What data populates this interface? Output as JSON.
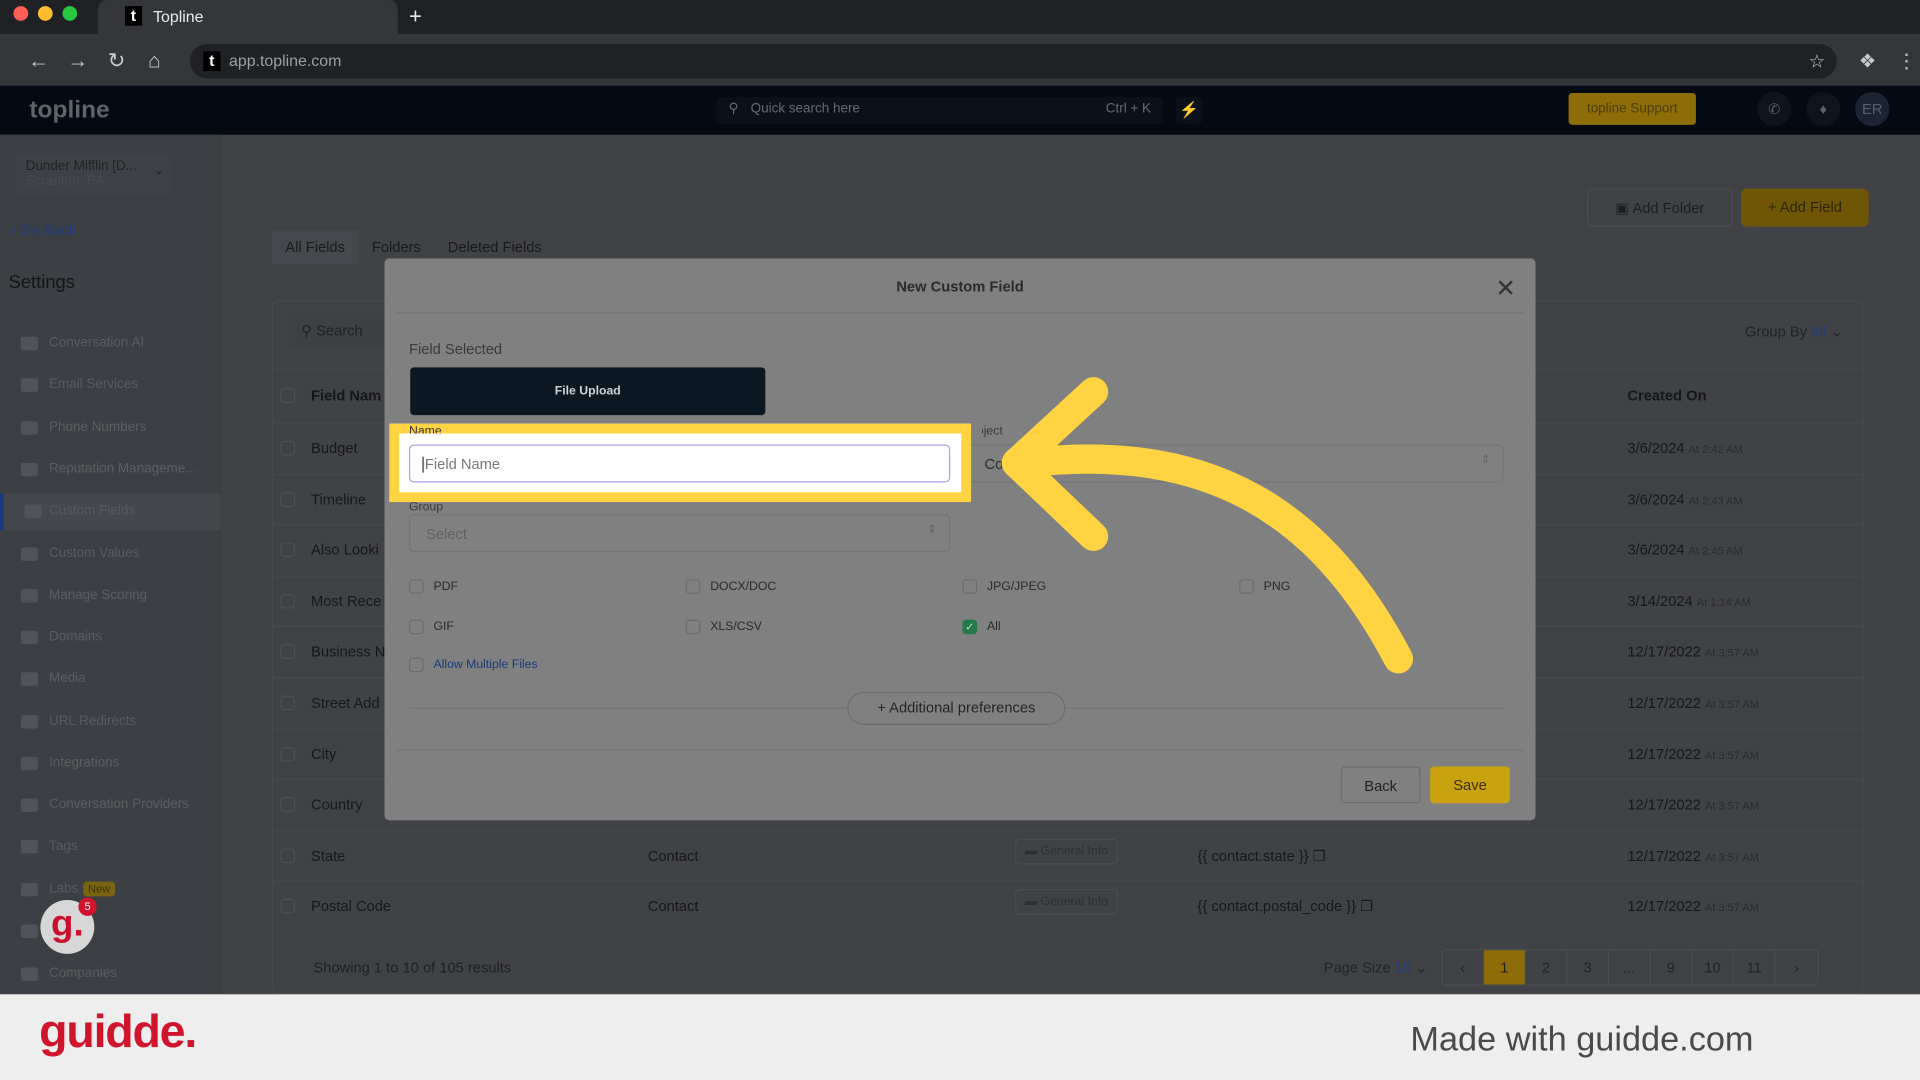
{
  "browser": {
    "tab_title": "Topline",
    "url": "app.topline.com",
    "favicon": "t"
  },
  "app": {
    "logo": "topline",
    "search_placeholder": "Quick search here",
    "search_shortcut": "Ctrl + K",
    "support_label": "topline Support",
    "avatar_initials": "ER"
  },
  "location": {
    "name": "Dunder Mifflin [D...",
    "sub": "Scranton, PA"
  },
  "sidebar": {
    "go_back": "Go Back",
    "title": "Settings",
    "new_badge": "New",
    "items": [
      {
        "label": "Conversation AI"
      },
      {
        "label": "Email Services"
      },
      {
        "label": "Phone Numbers"
      },
      {
        "label": "Reputation Manageme..."
      },
      {
        "label": "Custom Fields",
        "active": true
      },
      {
        "label": "Custom Values"
      },
      {
        "label": "Manage Scoring"
      },
      {
        "label": "Domains"
      },
      {
        "label": "Media"
      },
      {
        "label": "URL Redirects"
      },
      {
        "label": "Integrations"
      },
      {
        "label": "Conversation Providers"
      },
      {
        "label": "Tags"
      },
      {
        "label": "Labs"
      },
      {
        "label": "ogs"
      },
      {
        "label": "Companies"
      }
    ]
  },
  "main": {
    "add_folder": "Add Folder",
    "add_field": "+ Add Field",
    "tabs": [
      "All Fields",
      "Folders",
      "Deleted Fields"
    ],
    "search_placeholder": "Search",
    "group_by_label": "Group By",
    "group_by_value": "All",
    "columns": {
      "name": "Field Nam",
      "created": "Created On"
    },
    "rows": [
      {
        "name": "Budget",
        "date": "3/6/2024",
        "time": "At 2:42 AM"
      },
      {
        "name": "Timeline",
        "date": "3/6/2024",
        "time": "At 2:43 AM"
      },
      {
        "name": "Also Looki",
        "date": "3/6/2024",
        "time": "At 2:45 AM"
      },
      {
        "name": "Most Rece",
        "date": "3/14/2024",
        "time": "At 1:14 AM"
      },
      {
        "name": "Business N",
        "date": "12/17/2022",
        "time": "At 3:57 AM"
      },
      {
        "name": "Street Add",
        "date": "12/17/2022",
        "time": "At 3:57 AM"
      },
      {
        "name": "City",
        "date": "12/17/2022",
        "time": "At 3:57 AM"
      },
      {
        "name": "Country",
        "date": "12/17/2022",
        "time": "At 3:57 AM"
      },
      {
        "name": "State",
        "object": "Contact",
        "folder": "General Info",
        "key": "{{ contact.state }}",
        "date": "12/17/2022",
        "time": "At 3:57 AM"
      },
      {
        "name": "Postal Code",
        "object": "Contact",
        "folder": "General Info",
        "key": "{{ contact.postal_code }}",
        "date": "12/17/2022",
        "time": "At 3:57 AM"
      }
    ],
    "results_text": "Showing 1 to 10 of 105 results",
    "page_size_label": "Page Size",
    "page_size_value": "10",
    "pages": [
      "1",
      "2",
      "3",
      "...",
      "9",
      "10",
      "11"
    ],
    "current_page": "1"
  },
  "modal": {
    "title": "New Custom Field",
    "field_selected_label": "Field Selected",
    "field_type": "File Upload",
    "name_label": "Name",
    "name_placeholder": "Field Name",
    "object_label": "Object",
    "object_value": "Contact",
    "group_label": "Group",
    "group_placeholder": "Select",
    "file_types": [
      {
        "label": "PDF",
        "checked": false
      },
      {
        "label": "DOCX/DOC",
        "checked": false
      },
      {
        "label": "JPG/JPEG",
        "checked": false
      },
      {
        "label": "PNG",
        "checked": false
      },
      {
        "label": "GIF",
        "checked": false
      },
      {
        "label": "XLS/CSV",
        "checked": false
      },
      {
        "label": "All",
        "checked": true
      }
    ],
    "allow_multiple": "Allow Multiple Files",
    "additional_prefs": "+ Additional preferences",
    "back": "Back",
    "save": "Save"
  },
  "guidde": {
    "logo": "guidde.",
    "made_with": "Made with guidde.com",
    "avatar_letter": "g.",
    "badge_count": "5"
  },
  "colors": {
    "highlight": "#ffd342",
    "brand_yellow": "#f5b70a",
    "checked_green": "#247a4a",
    "guidde_red": "#d0142c"
  }
}
